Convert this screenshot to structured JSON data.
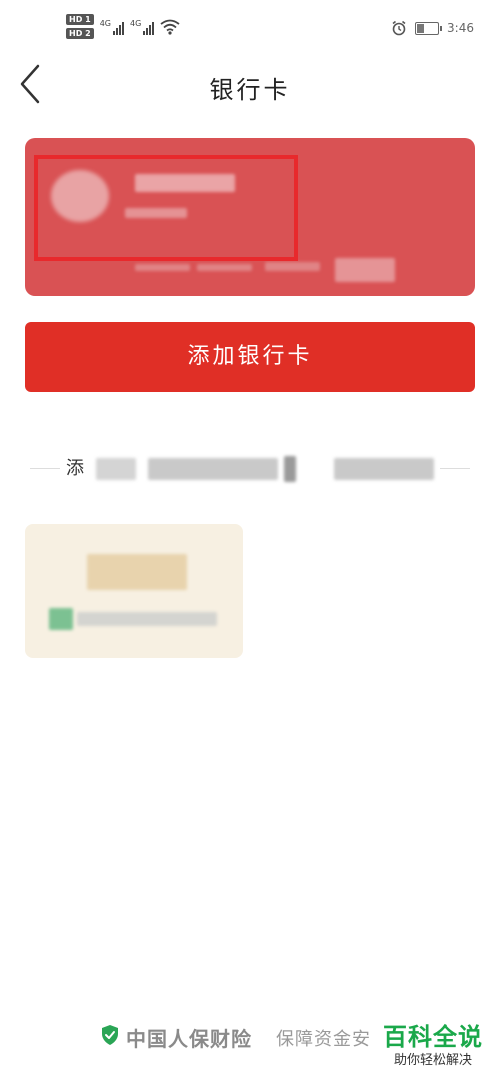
{
  "status_bar": {
    "sim1_badge": "HD 1",
    "sim2_badge": "HD 2",
    "network1": "4G",
    "network2": "4G",
    "time": "3:46",
    "battery_level": 0.3
  },
  "header": {
    "title": "银行卡",
    "back_icon": "chevron-left-icon"
  },
  "bank_card": {
    "background_color": "#d95254",
    "highlight_color": "#e8292c"
  },
  "add_card_button": {
    "label": "添加银行卡",
    "color": "#e02f26"
  },
  "section": {
    "label": "添"
  },
  "promo_card": {
    "background_color": "#f7f0e2"
  },
  "footer": {
    "icon": "shield-check-icon",
    "brand": "中国人保财险",
    "tagline": "保障资金安"
  },
  "watermark": {
    "title": "百科全说",
    "subtitle": "助你轻松解决"
  }
}
